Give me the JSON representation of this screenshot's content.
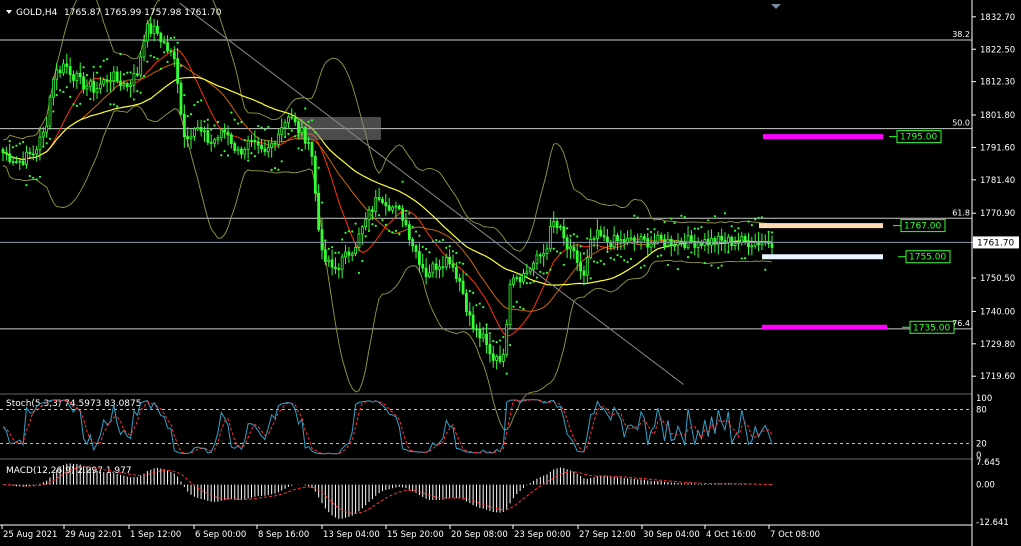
{
  "header": {
    "symbol": "GOLD,H4",
    "ohlc": "1765.87 1765.99 1757.98 1761.70"
  },
  "colors": {
    "background": "#000000",
    "grid": "#ffffff",
    "candle": "#33ff33",
    "ma_fast": "#ff3300",
    "ma_mid": "#cc6600",
    "ma_slow": "#ffff33",
    "bollinger": "#999944",
    "psar": "#33ff33",
    "trendline": "#888888",
    "fib_line": "#ffffff",
    "level_magenta": "#ff00ff",
    "level_peach": "#ffd9b3",
    "level_white": "#e8f4ff",
    "label_text": "#33ff33",
    "stoch_main": "#33a3c8",
    "stoch_signal": "#ff3333",
    "macd_hist": "#ffffff",
    "macd_signal": "#ff3333"
  },
  "chart_data": {
    "type": "candlestick",
    "price_axis": {
      "ticks": [
        "1832.70",
        "1822.50",
        "1812.30",
        "1801.80",
        "1791.60",
        "1781.40",
        "1770.90",
        "1761.70",
        "1750.50",
        "1740.00",
        "1729.80",
        "1719.60"
      ],
      "ylim": [
        1714,
        1838
      ]
    },
    "time_axis": {
      "ticks": [
        "25 Aug 2021",
        "29 Aug 22:01",
        "1 Sep 12:00",
        "6 Sep 00:00",
        "8 Sep 16:00",
        "13 Sep 04:00",
        "15 Sep 20:00",
        "20 Sep 08:00",
        "23 Sep 00:00",
        "27 Sep 12:00",
        "30 Sep 04:00",
        "4 Oct 16:00",
        "7 Oct 08:00"
      ]
    },
    "fib_levels": [
      {
        "label": "38.2",
        "price": 1825.4
      },
      {
        "label": "50.0",
        "price": 1797.5
      },
      {
        "label": "61.8",
        "price": 1769.3
      },
      {
        "label": "76.4",
        "price": 1734.5
      }
    ],
    "current_price": 1761.7,
    "current_price_label": "1761.70",
    "price_levels": [
      {
        "label": "1795.00",
        "price": 1795.0,
        "color": "magenta"
      },
      {
        "label": "1767.00",
        "price": 1767.0,
        "color": "peach"
      },
      {
        "label": "1755.00",
        "price": 1757.2,
        "color": "white"
      },
      {
        "label": "1735.00",
        "price": 1735.0,
        "color": "magenta"
      }
    ],
    "trendline": {
      "from": [
        0.23,
        1837
      ],
      "to": [
        0.885,
        1717
      ]
    },
    "stoch": {
      "label": "Stoch(5,3,3) 74.5973 83.0875",
      "levels": [
        "100",
        "80",
        "20",
        "0"
      ]
    },
    "macd": {
      "label": "MACD(12,26,9) 2.297 1.977",
      "ticks": [
        "7.645",
        "0.00",
        "-12.641"
      ]
    },
    "close_path": [
      [
        0.0,
        1790
      ],
      [
        0.02,
        1787
      ],
      [
        0.04,
        1790
      ],
      [
        0.055,
        1797
      ],
      [
        0.065,
        1814
      ],
      [
        0.08,
        1818
      ],
      [
        0.1,
        1812
      ],
      [
        0.12,
        1810
      ],
      [
        0.14,
        1814
      ],
      [
        0.16,
        1811
      ],
      [
        0.175,
        1815
      ],
      [
        0.185,
        1829
      ],
      [
        0.2,
        1828
      ],
      [
        0.215,
        1822
      ],
      [
        0.225,
        1818
      ],
      [
        0.235,
        1795
      ],
      [
        0.25,
        1798
      ],
      [
        0.27,
        1793
      ],
      [
        0.29,
        1797
      ],
      [
        0.305,
        1790
      ],
      [
        0.32,
        1793
      ],
      [
        0.34,
        1789
      ],
      [
        0.355,
        1795
      ],
      [
        0.37,
        1802
      ],
      [
        0.385,
        1797
      ],
      [
        0.4,
        1793
      ],
      [
        0.405,
        1780
      ],
      [
        0.415,
        1757
      ],
      [
        0.43,
        1753
      ],
      [
        0.445,
        1757
      ],
      [
        0.46,
        1762
      ],
      [
        0.475,
        1770
      ],
      [
        0.49,
        1777
      ],
      [
        0.505,
        1773
      ],
      [
        0.52,
        1770
      ],
      [
        0.535,
        1760
      ],
      [
        0.55,
        1752
      ],
      [
        0.565,
        1755
      ],
      [
        0.58,
        1757
      ],
      [
        0.595,
        1749
      ],
      [
        0.61,
        1735
      ],
      [
        0.625,
        1731
      ],
      [
        0.635,
        1725
      ],
      [
        0.645,
        1727
      ],
      [
        0.65,
        1723
      ],
      [
        0.66,
        1752
      ],
      [
        0.675,
        1751
      ],
      [
        0.69,
        1755
      ],
      [
        0.705,
        1759
      ],
      [
        0.715,
        1768
      ],
      [
        0.725,
        1765
      ],
      [
        0.735,
        1759
      ],
      [
        0.745,
        1757
      ],
      [
        0.755,
        1750
      ],
      [
        0.765,
        1762
      ],
      [
        0.775,
        1764
      ],
      [
        0.782,
        1762
      ]
    ]
  }
}
